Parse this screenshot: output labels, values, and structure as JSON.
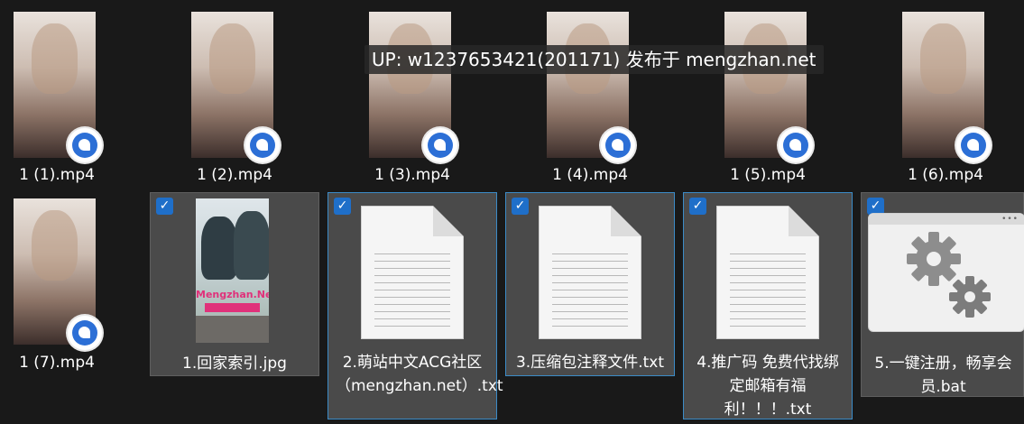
{
  "watermark": "UP: w1237653421(201171) 发布于 mengzhan.net",
  "files": [
    {
      "name": "1 (1).mp4",
      "type": "video"
    },
    {
      "name": "1 (2).mp4",
      "type": "video"
    },
    {
      "name": "1 (3).mp4",
      "type": "video"
    },
    {
      "name": "1 (4).mp4",
      "type": "video"
    },
    {
      "name": "1 (5).mp4",
      "type": "video"
    },
    {
      "name": "1 (6).mp4",
      "type": "video"
    },
    {
      "name": "1 (7).mp4",
      "type": "video"
    },
    {
      "name": "1.回家索引.jpg",
      "type": "image",
      "selected": true,
      "poster_brand": "Mengzhan.Net"
    },
    {
      "name": "2.萌站中文ACG社区（mengzhan.net）.txt",
      "type": "text",
      "selected": true
    },
    {
      "name": "3.压缩包注释文件.txt",
      "type": "text",
      "selected": true
    },
    {
      "name": "4.推广码 免费代找绑定邮箱有福利！！！.txt",
      "type": "text",
      "selected": true
    },
    {
      "name": "5.一键注册，畅享会员.bat",
      "type": "batch",
      "selected": true
    }
  ],
  "icons": {
    "checkbox": "check-icon",
    "video_overlay": "video-player-icon",
    "batch": "gears-icon"
  },
  "colors": {
    "background": "#191919",
    "selection": "#4a4a4a",
    "checkbox": "#1f6fc9"
  }
}
